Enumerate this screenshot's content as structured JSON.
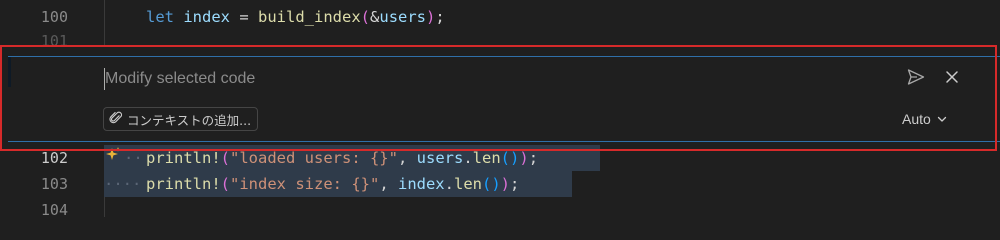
{
  "gutter": {
    "line_100": "100",
    "line_101": "101",
    "line_102": "102",
    "line_103": "103",
    "line_104": "104"
  },
  "code": {
    "line_100": {
      "keyword": "let",
      "var": "index",
      "eq": " = ",
      "fn": "build_index",
      "args_open": "(",
      "amp": "&",
      "arg": "users",
      "args_close": ")",
      "semi": ";"
    },
    "line_102": {
      "macro": "println!",
      "open": "(",
      "str": "\"loaded users: {}\"",
      "comma": ", ",
      "obj": "users",
      "dot": ".",
      "method": "len",
      "call": "()",
      "close": ")",
      "semi": ";"
    },
    "line_103": {
      "macro": "println!",
      "open": "(",
      "str": "\"index size: {}\"",
      "comma": ", ",
      "obj": "index",
      "dot": ".",
      "method": "len",
      "call": "()",
      "close": ")",
      "semi": ";"
    }
  },
  "inline_chat": {
    "placeholder": "Modify selected code",
    "context_button_label": "コンテキストの追加...",
    "model_label": "Auto"
  },
  "icons": {
    "send": "send-icon",
    "close": "close-icon",
    "attach": "paperclip-icon",
    "chevron": "chevron-down-icon",
    "sparkle": "sparkle-icon"
  },
  "colors": {
    "accent_border": "#2f6fa8",
    "highlight": "#d62a2a",
    "sparkle": "#e8b339"
  }
}
